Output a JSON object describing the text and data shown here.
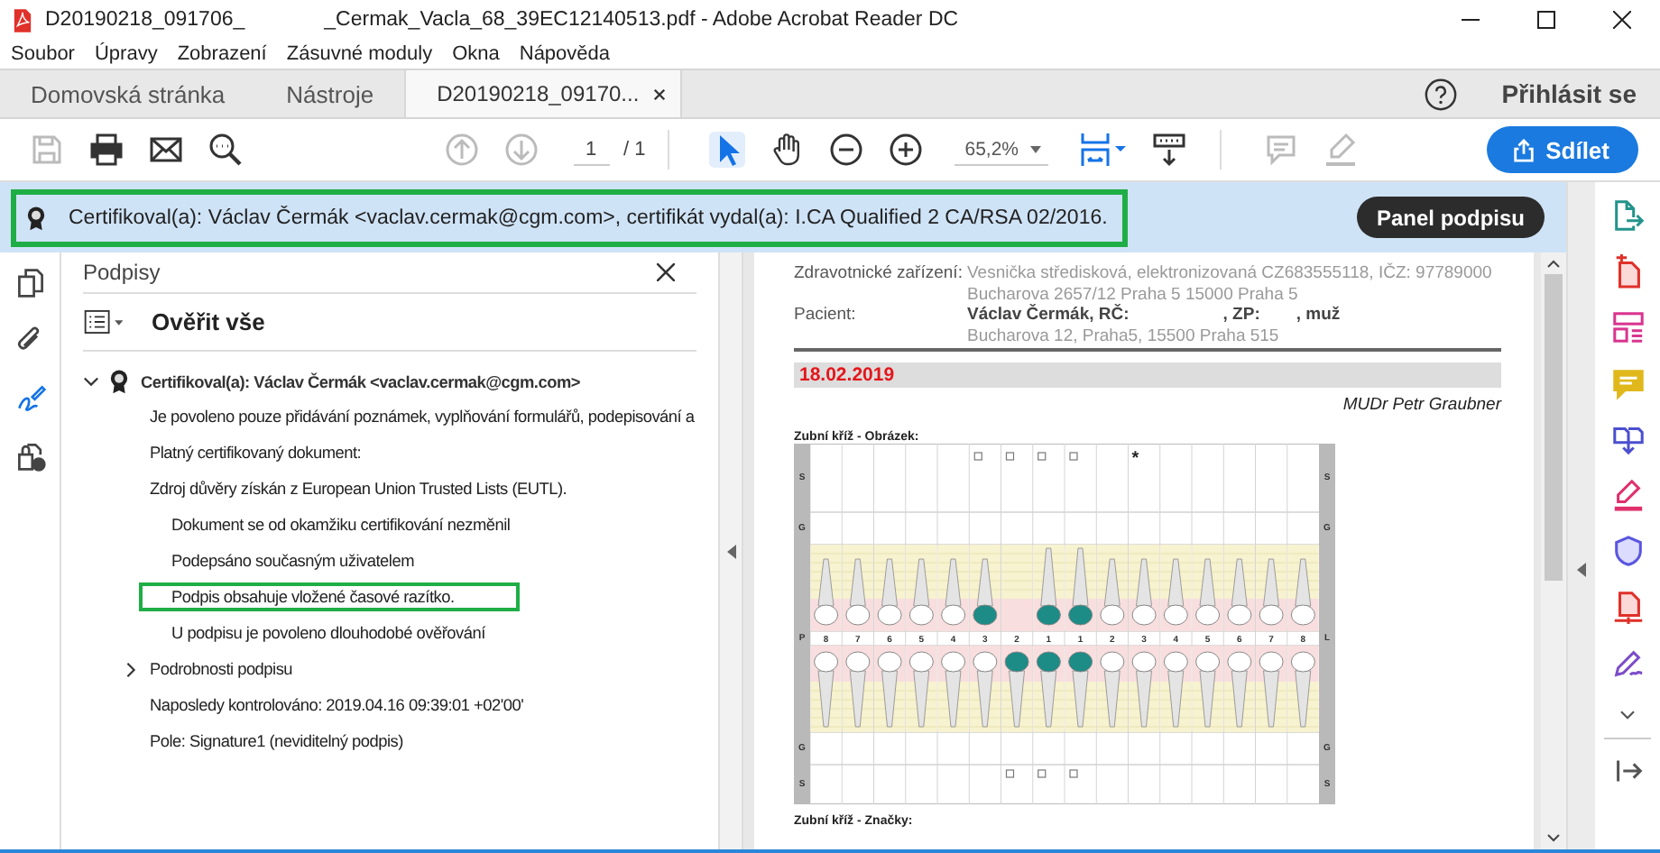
{
  "window": {
    "title_start": "D20190218_091706_",
    "title_end": "_Cermak_Vacla_68_39EC12140513.pdf - Adobe Acrobat Reader DC"
  },
  "menu": [
    "Soubor",
    "Úpravy",
    "Zobrazení",
    "Zásuvné moduly",
    "Okna",
    "Nápověda"
  ],
  "tabs": [
    {
      "label": "Domovská stránka",
      "selected": false,
      "closable": false
    },
    {
      "label": "Nástroje",
      "selected": false,
      "closable": false
    },
    {
      "label": "D20190218_09170...",
      "selected": true,
      "closable": true
    }
  ],
  "account": {
    "label": "Přihlásit se"
  },
  "toolbar": {
    "items": [
      {
        "kind": "save",
        "disabled": true,
        "selected": false
      },
      {
        "kind": "print",
        "disabled": false,
        "selected": false
      },
      {
        "kind": "mail",
        "disabled": false,
        "selected": false
      },
      {
        "kind": "search",
        "disabled": false,
        "selected": false
      },
      {
        "kind": "prev-page",
        "disabled": true,
        "selected": false
      },
      {
        "kind": "next-page",
        "disabled": true,
        "selected": false
      },
      {
        "kind": "page",
        "value": "1",
        "total": "/ 1"
      },
      {
        "kind": "separator"
      },
      {
        "kind": "pointer",
        "disabled": false,
        "selected": true
      },
      {
        "kind": "hand",
        "disabled": false,
        "selected": false
      },
      {
        "kind": "zoom-out",
        "disabled": false,
        "selected": false
      },
      {
        "kind": "zoom-in",
        "disabled": false,
        "selected": false
      },
      {
        "kind": "zoom",
        "value": "65,2%"
      },
      {
        "kind": "fit-page",
        "disabled": false,
        "selected": false
      },
      {
        "kind": "scroll-mode",
        "disabled": false,
        "selected": false
      },
      {
        "kind": "separator"
      },
      {
        "kind": "comment",
        "disabled": true,
        "selected": false
      },
      {
        "kind": "highlight",
        "disabled": true,
        "selected": false
      }
    ],
    "share": "Sdílet"
  },
  "banner": {
    "text": "Certifikoval(a): Václav Čermák <vaclav.cermak@cgm.com>, certifikát vydal(a): I.CA Qualified 2 CA/RSA 02/2016.",
    "highlighted": true,
    "button": "Panel podpisu"
  },
  "left_rail": [
    {
      "kind": "pages",
      "selected": false
    },
    {
      "kind": "attachments",
      "selected": false
    },
    {
      "kind": "signatures",
      "selected": true
    },
    {
      "kind": "security",
      "selected": false
    }
  ],
  "panel": {
    "title": "Podpisy",
    "action": "Ověřit vše",
    "signature": {
      "label": "Certifikoval(a): Václav Čermák <vaclav.cermak@cgm.com>",
      "expanded": true,
      "children": [
        {
          "kind": "line",
          "text": "Je povoleno pouze přidávání poznámek, vyplňování formulářů, podepisování a",
          "highlighted": false
        },
        {
          "kind": "line",
          "text": "Platný certifikovaný dokument:",
          "highlighted": false
        },
        {
          "kind": "line",
          "text": "Zdroj důvěry získán z European Union Trusted Lists (EUTL).",
          "highlighted": false,
          "children": [
            {
              "text": "Dokument se od okamžiku certifikování nezměnil",
              "highlighted": false
            },
            {
              "text": "Podepsáno současným uživatelem",
              "highlighted": false
            },
            {
              "text": "Podpis obsahuje vložené časové razítko.",
              "highlighted": true
            },
            {
              "text": "U podpisu je povoleno dlouhodobé ověřování",
              "highlighted": false
            }
          ]
        },
        {
          "kind": "expander",
          "text": "Podrobnosti podpisu",
          "highlighted": false,
          "expanded": false
        },
        {
          "kind": "line",
          "text": "Naposledy kontrolováno: 2019.04.16 09:39:01 +02'00'",
          "highlighted": false
        },
        {
          "kind": "line",
          "text": "Pole: Signature1 (neviditelný podpis)",
          "highlighted": false
        }
      ]
    }
  },
  "document": {
    "facility_label": "Zdravotnické zařízení:",
    "facility": [
      "Vesnička středisková, elektronizovaná CZ683555118, IČZ: 97789000",
      "Bucharova 2657/12 Praha 5 15000 Praha 5"
    ],
    "patient_label": "Pacient:",
    "patient_parts": [
      "Václav Čermák, RČ:",
      ", ZP:",
      ", muž"
    ],
    "patient_address": "Bucharova 12, Praha5, 15500 Praha 515",
    "date": "18.02.2019",
    "doctor": "MUDr Petr Graubner",
    "chart_title": "Zubní kříž - Obrázek:",
    "chart": {
      "left_column": [
        "S",
        "G",
        "P",
        "G",
        "S"
      ],
      "right_column": [
        "S",
        "G",
        "L",
        "G",
        "S"
      ],
      "teeth": [
        {
          "number": "8",
          "upper_present": true,
          "upper_treated": false,
          "lower_treated": false
        },
        {
          "number": "7",
          "upper_present": true,
          "upper_treated": false,
          "lower_treated": false
        },
        {
          "number": "6",
          "upper_present": true,
          "upper_treated": false,
          "lower_treated": false
        },
        {
          "number": "5",
          "upper_present": true,
          "upper_treated": false,
          "lower_treated": false
        },
        {
          "number": "4",
          "upper_present": true,
          "upper_treated": false,
          "lower_treated": false
        },
        {
          "number": "3",
          "upper_present": true,
          "upper_treated": true,
          "lower_treated": false,
          "top_marked": true
        },
        {
          "number": "2",
          "upper_present": false,
          "lower_treated": true,
          "top_marked": true,
          "bottom_marked": true
        },
        {
          "number": "1",
          "upper_present": true,
          "upper_treated": true,
          "lower_treated": true,
          "top_marked": true,
          "bottom_marked": true
        },
        {
          "number": "1",
          "upper_present": true,
          "upper_treated": true,
          "lower_treated": true,
          "top_marked": true,
          "bottom_marked": true
        },
        {
          "number": "2",
          "upper_present": true,
          "upper_treated": false,
          "lower_treated": false
        },
        {
          "number": "3",
          "upper_present": true,
          "upper_treated": false,
          "lower_treated": false,
          "top_symbol": "*"
        },
        {
          "number": "4",
          "upper_present": true,
          "upper_treated": false,
          "lower_treated": false
        },
        {
          "number": "5",
          "upper_present": true,
          "upper_treated": false,
          "lower_treated": false
        },
        {
          "number": "6",
          "upper_present": true,
          "upper_treated": false,
          "lower_treated": false
        },
        {
          "number": "7",
          "upper_present": true,
          "upper_treated": false,
          "lower_treated": false
        },
        {
          "number": "8",
          "upper_present": true,
          "upper_treated": false,
          "lower_treated": false
        }
      ]
    },
    "next_title": "Zubní kříž - Značky:"
  },
  "right_tools": [
    {
      "kind": "export"
    },
    {
      "kind": "create"
    },
    {
      "kind": "organize"
    },
    {
      "kind": "comment"
    },
    {
      "kind": "combine"
    },
    {
      "kind": "fill-sign"
    },
    {
      "kind": "protect"
    },
    {
      "kind": "compress"
    },
    {
      "kind": "sign"
    },
    {
      "kind": "more"
    }
  ]
}
